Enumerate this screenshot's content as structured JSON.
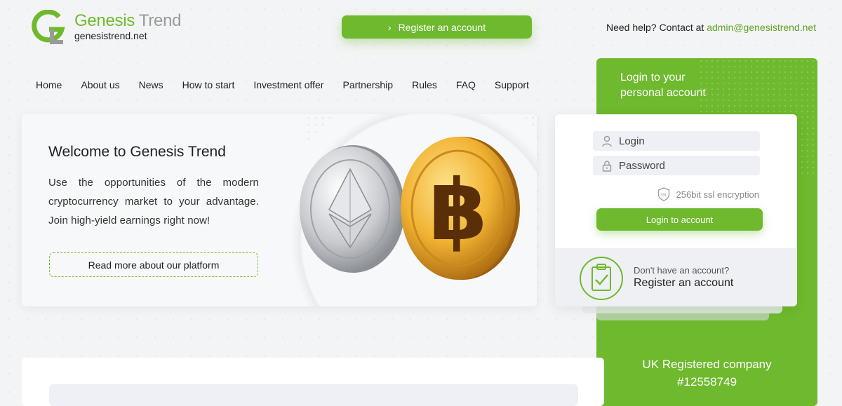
{
  "header": {
    "brand_part1": "Genesis",
    "brand_part2": "Trend",
    "domain": "genesistrend.net",
    "register_button": "Register an account",
    "help_text": "Need help? Contact at",
    "help_email": "admin@genesistrend.net"
  },
  "nav": [
    "Home",
    "About us",
    "News",
    "How to start",
    "Investment offer",
    "Partnership",
    "Rules",
    "FAQ",
    "Support"
  ],
  "hero": {
    "title": "Welcome to Genesis Trend",
    "text": "Use the opportunities of the modern cryptocurrency market to your advantage. Join high-yield earnings right now!",
    "read_more": "Read more about our platform"
  },
  "login_panel": {
    "title_line1": "Login to your",
    "title_line2": "personal account",
    "login_placeholder": "Login",
    "password_placeholder": "Password",
    "ssl_text": "256bit ssl encryption",
    "ssl_badge": "SSL",
    "login_button": "Login to account",
    "dont_have": "Don't have an account?",
    "register_link": "Register an account",
    "company_line1": "UK Registered company",
    "company_line2": "#12558749"
  },
  "colors": {
    "accent": "#6eb92d",
    "link": "#5ea424"
  }
}
